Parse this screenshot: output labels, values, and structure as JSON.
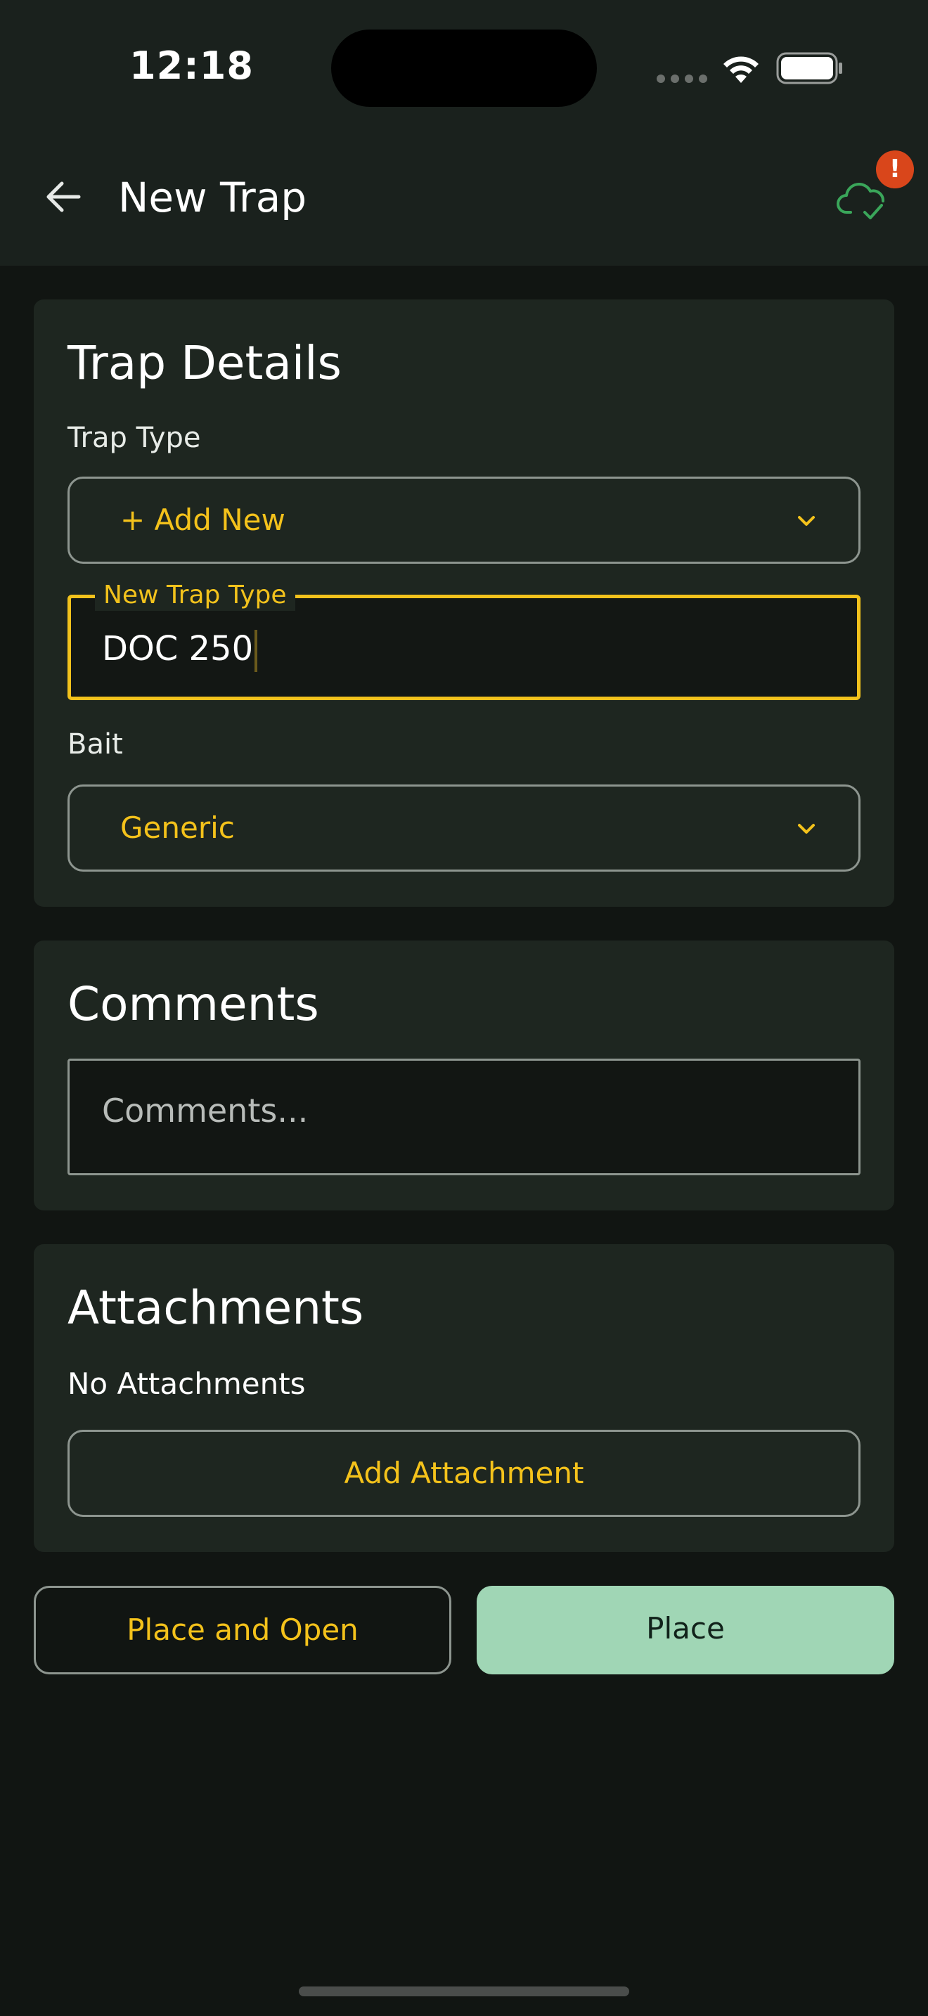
{
  "status_bar": {
    "time": "12:18"
  },
  "header": {
    "title": "New Trap",
    "alert_badge": "!",
    "back_icon": "arrow-left-icon",
    "sync_icon": "cloud-check-icon"
  },
  "trap_details": {
    "title": "Trap Details",
    "trap_type_label": "Trap Type",
    "trap_type_value": "+ Add New",
    "new_trap_type_label": "New Trap Type",
    "new_trap_type_value": "DOC 250",
    "bait_label": "Bait",
    "bait_value": "Generic"
  },
  "comments": {
    "title": "Comments",
    "placeholder": "Comments..."
  },
  "attachments": {
    "title": "Attachments",
    "empty_text": "No Attachments",
    "add_button": "Add Attachment"
  },
  "actions": {
    "place_and_open": "Place and Open",
    "place": "Place"
  },
  "colors": {
    "accent": "#f4c21b",
    "primary_button": "#a0d6b5",
    "alert": "#d9461b",
    "sync_ok": "#3aa65a"
  }
}
